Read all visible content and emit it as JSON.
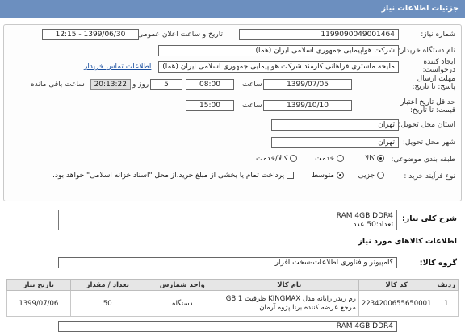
{
  "header": {
    "title": "جزئیات اطلاعات نیاز"
  },
  "form": {
    "need_number": {
      "label": "شماره نیاز:",
      "value": "1199090049001464"
    },
    "announce_datetime": {
      "label": "تاریخ و ساعت اعلان عمومی:",
      "value": "1399/06/30 - 12:15"
    },
    "buyer_org": {
      "label": "نام دستگاه خریدار:",
      "value": "شرکت هواپیمایی جمهوری اسلامی ایران (هما)"
    },
    "creator": {
      "label": "ایجاد کننده درخواست:",
      "value": "ملیحه ماستری فراهانی کارمند شرکت هواپیمایی جمهوری اسلامی ایران (هما)",
      "contact_link": "اطلاعات تماس خریدار"
    },
    "reply_deadline": {
      "label": "مهلت ارسال پاسخ: تا تاریخ:",
      "date": "1399/07/05",
      "time_label": "ساعت",
      "time": "08:00",
      "days": "5",
      "days_label": "روز و",
      "remaining": "20:13:22",
      "remaining_label": "ساعت باقی مانده"
    },
    "price_validity": {
      "label": "حداقل تاریخ اعتبار قیمت: تا تاریخ:",
      "date": "1399/10/10",
      "time_label": "ساعت",
      "time": "15:00"
    },
    "delivery_province": {
      "label": "استان محل تحویل:",
      "value": "تهران"
    },
    "delivery_city": {
      "label": "شهر محل تحویل:",
      "value": "تهران"
    },
    "category": {
      "label": "طبقه بندی موضوعی:",
      "options": [
        "کالا",
        "خدمت",
        "کالا/خدمت"
      ],
      "selected": "کالا"
    },
    "process_type": {
      "label": "نوع فرآیند خرید :",
      "options": [
        "جزیی",
        "متوسط"
      ],
      "selected": "متوسط",
      "payment_note": "پرداخت تمام یا بخشی از مبلغ خرید،از محل \"اسناد خزانه اسلامی\" خواهد بود."
    }
  },
  "summary": {
    "label": "شرح کلی نیاز:",
    "line1": "RAM 4GB DDR4",
    "line2": "تعداد:50 عدد"
  },
  "goods": {
    "section_title": "اطلاعات کالاهای مورد نیاز",
    "group_label": "گروه کالا:",
    "group_value": "کامپیوتر و فناوری اطلاعات-سخت افزار"
  },
  "table": {
    "headers": [
      "ردیف",
      "کد کالا",
      "نام کالا",
      "واحد شمارش",
      "تعداد / مقدار",
      "تاریخ نیاز"
    ],
    "rows": [
      {
        "row": "1",
        "code": "2234200655650001",
        "name": "رم ریدر رایانه مدل KINGMAX ظرفیت 1 GB مرجع عرضه کننده برنا پژوه آرمان",
        "unit": "دستگاه",
        "qty": "50",
        "date": "1399/07/06"
      }
    ]
  },
  "footer_note": {
    "value": "RAM 4GB DDR4"
  }
}
